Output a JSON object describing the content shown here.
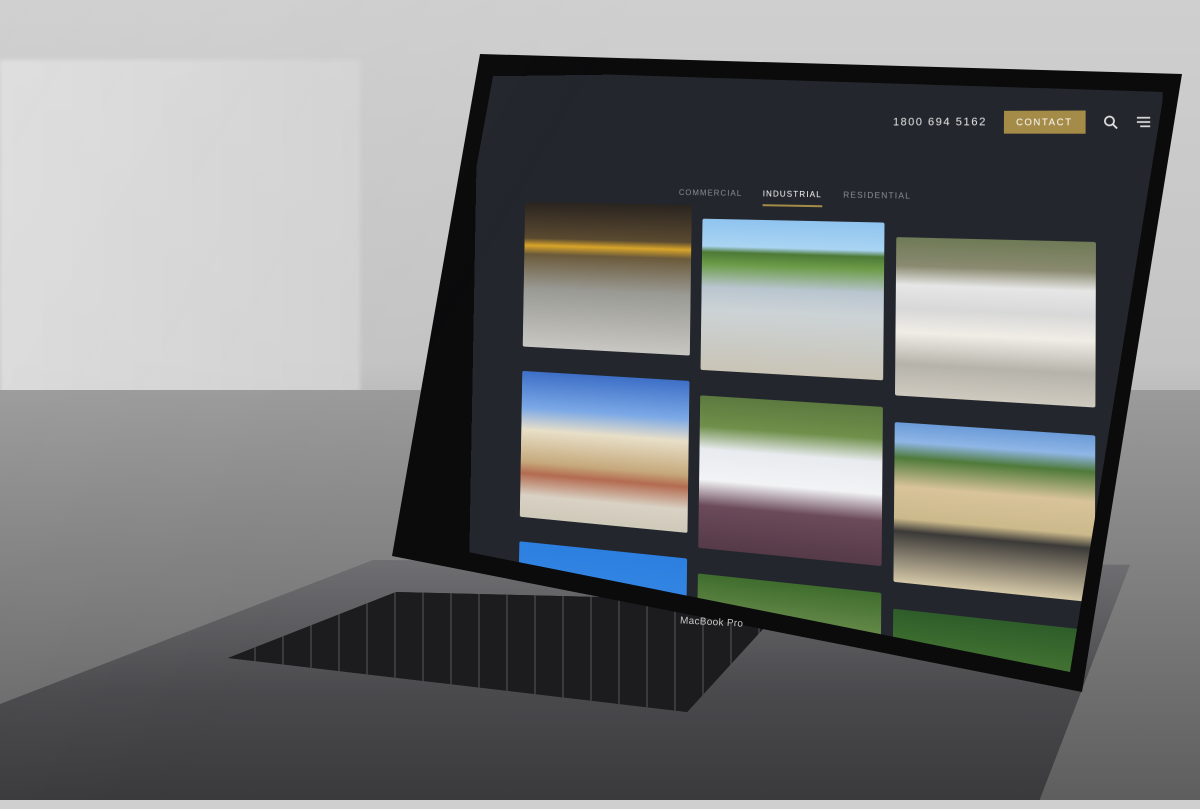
{
  "device": {
    "brand_label": "MacBook Pro"
  },
  "header": {
    "phone": "1800 694 5162",
    "contact_label": "CONTACT",
    "search_icon": "search-icon",
    "menu_icon": "hamburger-menu-icon"
  },
  "tabs": [
    {
      "label": "COMMERCIAL",
      "active": false
    },
    {
      "label": "INDUSTRIAL",
      "active": true
    },
    {
      "label": "RESIDENTIAL",
      "active": false
    }
  ],
  "colors": {
    "accent": "#a58b48",
    "screen_bg": "#23272d"
  }
}
